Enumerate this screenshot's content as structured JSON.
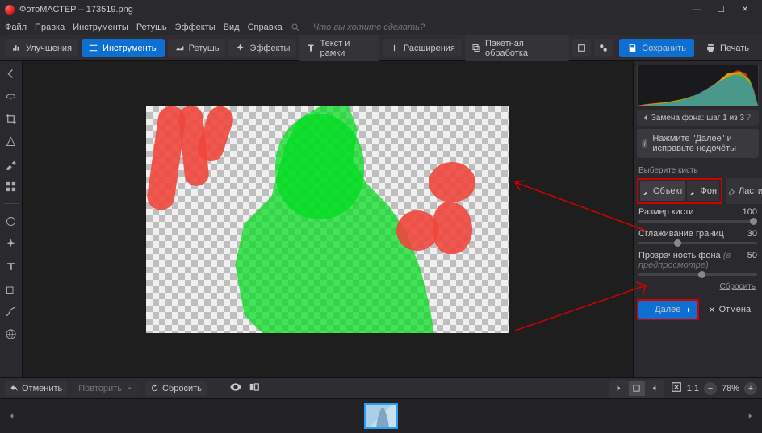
{
  "window": {
    "title": "ФотоМАСТЕР – 173519.png"
  },
  "menu": {
    "items": [
      "Файл",
      "Правка",
      "Инструменты",
      "Ретушь",
      "Эффекты",
      "Вид",
      "Справка"
    ],
    "search_placeholder": "Что вы хотите сделать?"
  },
  "toolbar": {
    "improve": "Улучшения",
    "tools": "Инструменты",
    "retouch": "Ретушь",
    "effects": "Эффекты",
    "text": "Текст и рамки",
    "extensions": "Расширения",
    "batch": "Пакетная обработка",
    "save": "Сохранить",
    "print": "Печать"
  },
  "bottombar": {
    "undo": "Отменить",
    "redo": "Повторить",
    "reset": "Сбросить",
    "fit": "1:1",
    "zoom": "78%"
  },
  "panel": {
    "step_title": "Замена фона: шаг 1 из 3",
    "hint": "Нажмите \"Далее\" и исправьте недочёты",
    "choose_brush": "Выберите кисть",
    "brush_object": "Объект",
    "brush_bg": "Фон",
    "brush_eraser": "Ластик",
    "size_label": "Размер кисти",
    "size_value": "100",
    "smooth_label": "Сглаживание границ",
    "smooth_value": "30",
    "opacity_label": "Прозрачность фона",
    "opacity_note": "(в предпросмотре)",
    "opacity_value": "50",
    "reset": "Сбросить",
    "next": "Далее",
    "cancel": "Отмена"
  }
}
